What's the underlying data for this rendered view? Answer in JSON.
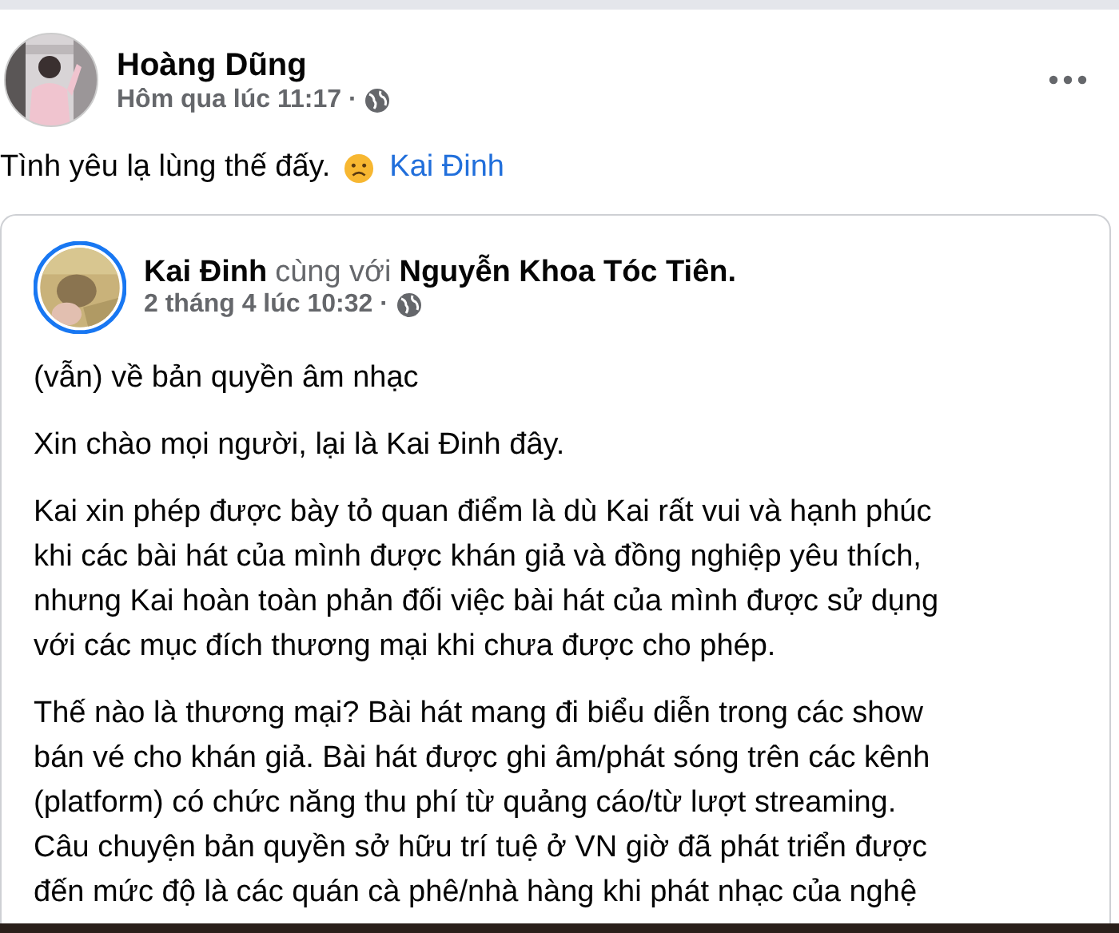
{
  "post": {
    "author": "Hoàng Dũng",
    "time": "Hôm qua lúc 11:17 ·",
    "text": "Tình yêu lạ lùng thế đấy.",
    "mention": "Kai Đinh"
  },
  "shared": {
    "author": "Kai Đinh",
    "with_word": "cùng với",
    "with_name": "Nguyễn Khoa Tóc Tiên.",
    "time": "2 tháng 4 lúc 10:32 ·",
    "paragraphs": [
      [
        "(vẫn) về bản quyền âm nhạc"
      ],
      [
        "Xin chào mọi người, lại là Kai Đinh đây."
      ],
      [
        "Kai xin phép được bày tỏ quan điểm là dù Kai rất vui và hạnh phúc",
        "khi các bài hát của mình được khán giả và đồng nghiệp yêu thích,",
        "nhưng Kai hoàn toàn phản đối việc bài hát của mình được sử dụng",
        "với các mục đích thương mại khi chưa được cho phép."
      ],
      [
        "Thế nào là thương mại? Bài hát mang đi biểu diễn trong các show",
        "bán vé cho khán giả. Bài hát được ghi âm/phát sóng trên các kênh",
        "(platform) có chức năng thu phí từ quảng cáo/từ lượt streaming.",
        "Câu chuyện bản quyền sở hữu trí tuệ ở VN giờ đã phát triển được",
        "đến mức độ là các quán cà phê/nhà hàng khi phát nhạc của nghệ"
      ]
    ]
  }
}
